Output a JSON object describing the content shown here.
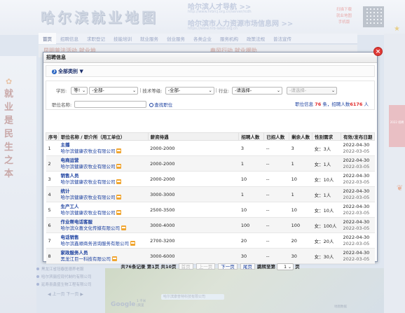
{
  "background": {
    "logo": "哈尔滨就业地图",
    "portal1": {
      "title": "哈尔滨人才导航 >>",
      "url": "http://www.hrbrcj.org.cn/server/rcdh"
    },
    "portal2": {
      "title": "哈尔滨市人力资源市场信息网 >>",
      "url": "https://www.hrb-labor.org.cn"
    },
    "hotline": [
      "扫描下载",
      "就业地图",
      "手机版"
    ],
    "calligraphy": "就业是民生之本",
    "nav": [
      "首页",
      "招聘信息",
      "求职登记",
      "技能培训",
      "就业服务",
      "创业服务",
      "各类企业",
      "服务机构",
      "政策法规",
      "普法宣传"
    ],
    "strip_left": "昆明普法活动 就业地",
    "strip_right": "春风行动 就业援助",
    "promo": "2022 招聘",
    "links": [
      "黑龙江省冠春医德养老服",
      "哈尔滨骊控现代制约有限公司",
      "延寿县鑫盛生物工程有限公司"
    ],
    "pager": "◀ 上一页 下一页 ▶",
    "map": {
      "brand": "Google",
      "scale": "1 千米",
      "road": "哈尔滨康普特科技有限公司",
      "road_sub": "|奥里",
      "label": "地图数据"
    }
  },
  "modal": {
    "title": "招聘信息",
    "category": "全部类别",
    "filters": {
      "education_label": "学历:",
      "edu_compare": "等!",
      "edu_value": "-全部-",
      "skill_label": "技术等级:",
      "skill_value": "-全部-",
      "industry_label": "行业:",
      "industry_value": "-请选择-",
      "sub_value": "-请选择-",
      "job_label": "职位名称:",
      "search_label": "查找职位",
      "stat_prefix": "职位信息",
      "stat_count": "76",
      "stat_mid": "条，招聘人数",
      "stat_people": "6176",
      "stat_suffix": "人"
    },
    "table": {
      "headers": [
        "序号",
        "职位名称 / 职介所（用工单位）",
        "薪资待遇",
        "招聘人数",
        "已招人数",
        "剩余人数",
        "性别需求",
        "有效/发布日期"
      ],
      "rows": [
        {
          "no": "1",
          "title": "主播",
          "company": "哈尔滨健康农牧业有限公司",
          "salary": "2000-2000",
          "hire": "3",
          "hired": "--",
          "left": "3",
          "gender": "女：3人",
          "valid": "2022-04-30",
          "pub": "2022-03-05"
        },
        {
          "no": "2",
          "title": "电商运营",
          "company": "哈尔滨健康农牧业有限公司",
          "salary": "2000-2000",
          "hire": "1",
          "hired": "--",
          "left": "1",
          "gender": "女：1人",
          "valid": "2022-04-30",
          "pub": "2022-03-05"
        },
        {
          "no": "3",
          "title": "销售人员",
          "company": "哈尔滨健康农牧业有限公司",
          "salary": "2000-2000",
          "hire": "10",
          "hired": "--",
          "left": "10",
          "gender": "女：10人",
          "valid": "2022-04-30",
          "pub": "2022-03-05"
        },
        {
          "no": "4",
          "title": "统计",
          "company": "哈尔滨健康农牧业有限公司",
          "salary": "3000-3000",
          "hire": "1",
          "hired": "--",
          "left": "1",
          "gender": "女：1人",
          "valid": "2022-04-30",
          "pub": "2022-03-05"
        },
        {
          "no": "5",
          "title": "生产工人",
          "company": "哈尔滨健康农牧业有限公司",
          "salary": "2500-3500",
          "hire": "10",
          "hired": "--",
          "left": "10",
          "gender": "女：10人",
          "valid": "2022-04-30",
          "pub": "2022-03-05"
        },
        {
          "no": "6",
          "title": "作业帮电话客服",
          "company": "哈尔滨众喜文化传媒有限公司",
          "salary": "3000-4000",
          "hire": "100",
          "hired": "--",
          "left": "100",
          "gender": "女：100人",
          "valid": "2022-04-30",
          "pub": "2022-03-05"
        },
        {
          "no": "7",
          "title": "电话销售",
          "company": "哈尔滨鑫顺商务咨询服务有限公司",
          "salary": "2700-3200",
          "hire": "20",
          "hired": "--",
          "left": "20",
          "gender": "女：20人",
          "valid": "2022-04-30",
          "pub": "2022-03-05"
        },
        {
          "no": "8",
          "title": "家政服务人员",
          "company": "黑龙江巨一科技有限公司",
          "salary": "3000-6000",
          "hire": "30",
          "hired": "--",
          "left": "30",
          "gender": "女：30人",
          "valid": "2022-04-30",
          "pub": "2022-03-05"
        }
      ]
    },
    "pager": {
      "summary": "共76条记录 第1页 共10页",
      "first": "首页",
      "prev": "上一页",
      "next": "下一页",
      "last": "尾页",
      "jump_label": "跳转至第",
      "jump_value": "1",
      "page_suffix": "页"
    }
  }
}
